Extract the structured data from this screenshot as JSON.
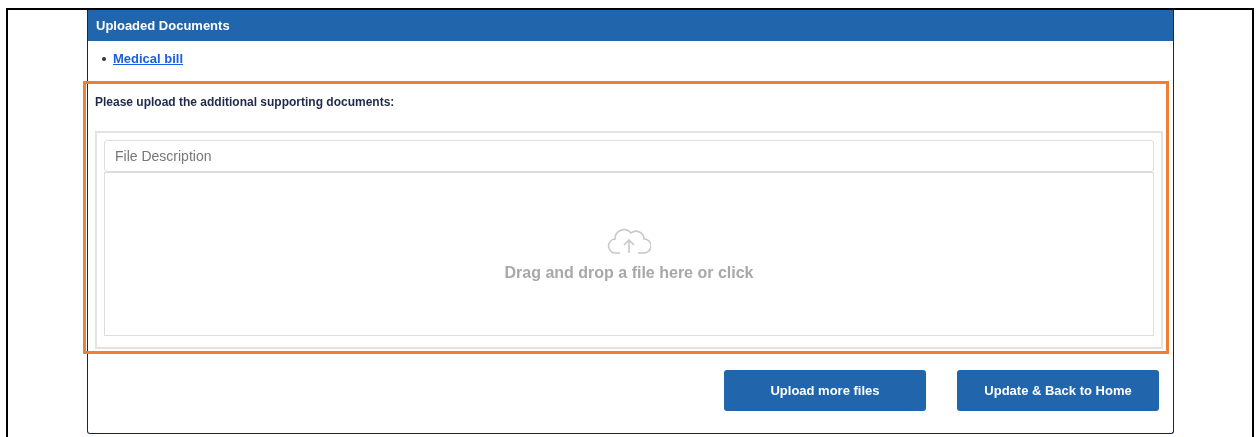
{
  "panel": {
    "title": "Uploaded Documents"
  },
  "documents": [
    {
      "name": "Medical bill"
    }
  ],
  "upload": {
    "prompt": "Please upload the additional supporting documents:",
    "description_placeholder": "File Description",
    "dropzone_text": "Drag and drop a file here or click",
    "highlighted": true
  },
  "buttons": [
    "Upload more files",
    "Update & Back to Home"
  ]
}
